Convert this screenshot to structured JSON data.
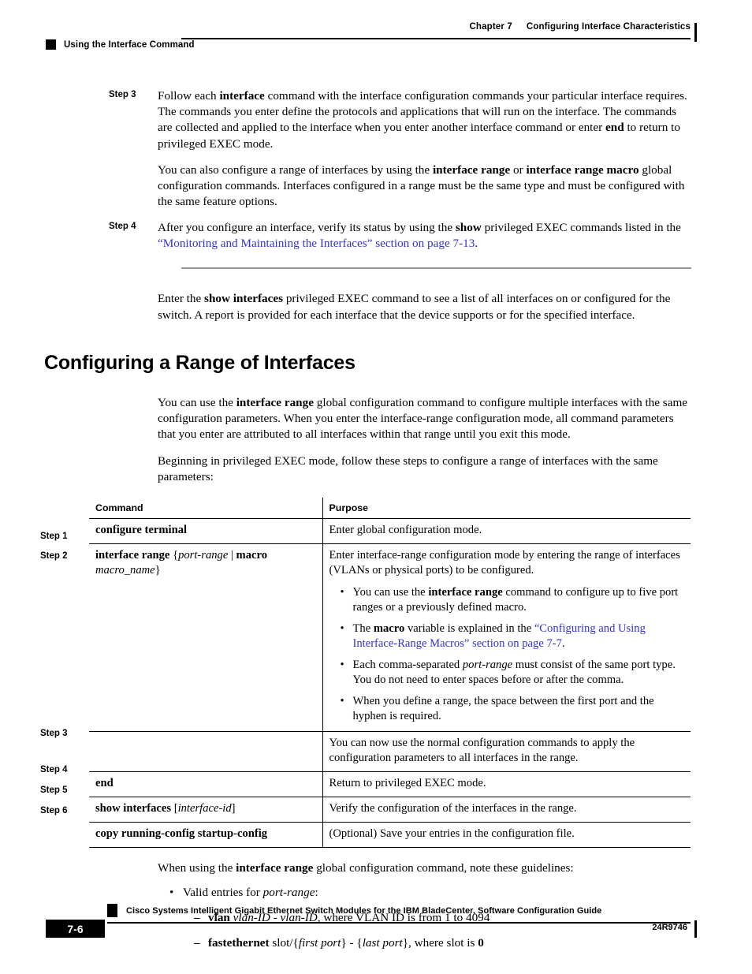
{
  "header": {
    "chapter_num": "Chapter 7",
    "chapter_title": "Configuring Interface Characteristics",
    "running_head": "Using the Interface Command"
  },
  "steps_top": {
    "step3_label": "Step 3",
    "step3_p1_a": "Follow each ",
    "step3_p1_b": "interface",
    "step3_p1_c": " command with the interface configuration commands your particular interface requires. The commands you enter define the protocols and applications that will run on the interface. The commands are collected and applied to the interface when you enter another interface command or enter ",
    "step3_p1_d": "end",
    "step3_p1_e": " to return to privileged EXEC mode.",
    "step3_p2_a": "You can also configure a range of interfaces by using the ",
    "step3_p2_b": "interface range",
    "step3_p2_c": " or ",
    "step3_p2_d": "interface range macro",
    "step3_p2_e": " global configuration commands. Interfaces configured in a range must be the same type and must be configured with the same feature options.",
    "step4_label": "Step 4",
    "step4_p1_a": "After you configure an interface, verify its status by using the ",
    "step4_p1_b": "show",
    "step4_p1_c": " privileged EXEC commands listed in the ",
    "step4_link": "“Monitoring and Maintaining the Interfaces” section on page 7-13",
    "step4_p1_d": "."
  },
  "intro": {
    "p1_a": "Enter the ",
    "p1_b": "show interfaces",
    "p1_c": " privileged EXEC command to see a list of all interfaces on or configured for the switch. A report is provided for each interface that the device supports or for the specified interface."
  },
  "section": {
    "title": "Configuring a Range of Interfaces",
    "p1_a": "You can use the ",
    "p1_b": "interface range",
    "p1_c": " global configuration command to configure multiple interfaces with the same configuration parameters. When you enter the interface-range configuration mode, all command parameters that you enter are attributed to all interfaces within that range until you exit this mode.",
    "p2": "Beginning in privileged EXEC mode, follow these steps to configure a range of interfaces with the same parameters:"
  },
  "table": {
    "headers": {
      "command": "Command",
      "purpose": "Purpose"
    },
    "step_labels": [
      "Step 1",
      "Step 2",
      "Step 3",
      "Step 4",
      "Step 5",
      "Step 6"
    ],
    "rows": [
      {
        "step": "Step 1",
        "command": "configure terminal",
        "purpose": "Enter global configuration mode."
      },
      {
        "step": "Step 2",
        "command_b1": "interface range",
        "command_lit1": " {",
        "command_i1": "port-range",
        "command_lit2": " | ",
        "command_b2": "macro",
        "command_i2": "macro_name",
        "command_lit3": "}",
        "purpose_intro": "Enter interface-range configuration mode by entering the range of interfaces (VLANs or physical ports) to be configured.",
        "bullets": [
          {
            "a": "You can use the ",
            "b": "interface range",
            "c": " command to configure up to five port ranges or a previously defined macro."
          },
          {
            "a": "The ",
            "b": "macro",
            "c": " variable is explained in the ",
            "link": "“Configuring and Using Interface-Range Macros” section on page 7-7",
            "d": "."
          },
          {
            "a": "Each comma-separated ",
            "i": "port-range",
            "c": " must consist of the same port type. You do not need to enter spaces before or after the comma."
          },
          {
            "a": "When you define a range, the space between the first port and the hyphen is required."
          }
        ]
      },
      {
        "step": "Step 3",
        "command": "",
        "purpose": "You can now use the normal configuration commands to apply the configuration parameters to all interfaces in the range."
      },
      {
        "step": "Step 4",
        "command": "end",
        "purpose": "Return to privileged EXEC mode."
      },
      {
        "step": "Step 5",
        "command_b1": "show interfaces",
        "command_lit1": " [",
        "command_i1": "interface-id",
        "command_lit2": "]",
        "purpose": "Verify the configuration of the interfaces in the range."
      },
      {
        "step": "Step 6",
        "command": "copy running-config startup-config",
        "purpose": "(Optional) Save your entries in the configuration file."
      }
    ]
  },
  "guidelines": {
    "intro_a": "When using the ",
    "intro_b": "interface range",
    "intro_c": " global configuration command, note these guidelines:",
    "l1_a": "Valid entries for ",
    "l1_i": "port-range",
    "l1_c": ":",
    "sub1_b": "vlan",
    "sub1_i1": "vlan-ID",
    "sub1_lit1": " - ",
    "sub1_i2": "vlan-ID",
    "sub1_rest": ", where VLAN ID is from 1 to 4094",
    "sub2_b": "fastethernet",
    "sub2_lit1": " slot/{",
    "sub2_i1": "first port",
    "sub2_lit2": "} - {",
    "sub2_i2": "last port",
    "sub2_lit3": "}, where slot is ",
    "sub2_bold_end": "0"
  },
  "footer": {
    "doc_title": "Cisco Systems Intelligent Gigabit Ethernet Switch Modules for the IBM BladeCenter, Software Configuration Guide",
    "page_number": "7-6",
    "doc_number": "24R9746"
  },
  "colors": {
    "link": "#3333cc",
    "rule_gray": "#959595",
    "ink": "#000000"
  }
}
